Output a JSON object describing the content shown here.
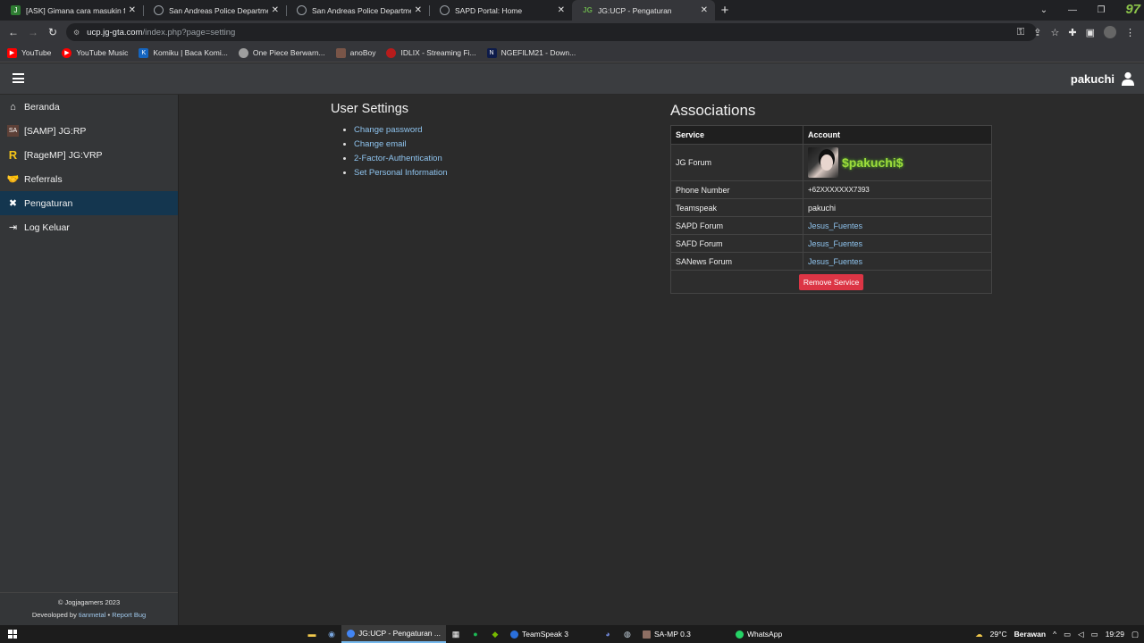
{
  "browser": {
    "tabs": [
      {
        "title": "[ASK] Gimana cara masukin foru",
        "icon": "jg-forum-icon",
        "color": "#2e7d32",
        "active": false
      },
      {
        "title": "San Andreas Police Department",
        "icon": "globe-icon",
        "color": "#9aa0a6",
        "active": false
      },
      {
        "title": "San Andreas Police Department",
        "icon": "globe-icon",
        "color": "#9aa0a6",
        "active": false
      },
      {
        "title": "SAPD Portal: Home",
        "icon": "globe-icon",
        "color": "#9aa0a6",
        "active": false
      },
      {
        "title": "JG:UCP - Pengaturan",
        "icon": "jg-icon",
        "color": "#2e7d32",
        "active": true
      }
    ],
    "url_host": "ucp.jg-gta.com",
    "url_path": "/index.php?page=setting",
    "badge": "97",
    "bookmarks": [
      {
        "label": "YouTube",
        "color": "#ff0000"
      },
      {
        "label": "YouTube Music",
        "color": "#ff0000"
      },
      {
        "label": "Komiku | Baca Komi...",
        "color": "#1565c0"
      },
      {
        "label": "One Piece Berwarn...",
        "color": "#9e9e9e"
      },
      {
        "label": "anoBoy",
        "color": "#795548"
      },
      {
        "label": "IDLIX - Streaming Fi...",
        "color": "#b71c1c"
      },
      {
        "label": "NGEFILM21 - Down...",
        "color": "#0d1b4a"
      }
    ]
  },
  "header": {
    "username": "pakuchi"
  },
  "sidebar": {
    "items": [
      {
        "label": "Beranda",
        "icon": "home-icon",
        "active": false
      },
      {
        "label": "[SAMP] JG:RP",
        "icon": "samp-icon",
        "active": false
      },
      {
        "label": "[RageMP] JG:VRP",
        "icon": "ragemp-icon",
        "active": false
      },
      {
        "label": "Referrals",
        "icon": "handshake-icon",
        "active": false
      },
      {
        "label": "Pengaturan",
        "icon": "tools-icon",
        "active": true
      },
      {
        "label": "Log Keluar",
        "icon": "sign-out-icon",
        "active": false
      }
    ],
    "footer_copyright": "© Jogjagamers 2023",
    "footer_developed": "Deveoloped by",
    "footer_developer": "tianmetal",
    "footer_separator": "•",
    "footer_report": "Report Bug"
  },
  "user_settings": {
    "title": "User Settings",
    "links": [
      "Change password",
      "Change email",
      "2-Factor-Authentication",
      "Set Personal Information"
    ]
  },
  "associations": {
    "title": "Associations",
    "col_service": "Service",
    "col_account": "Account",
    "rows": [
      {
        "service": "JG Forum",
        "account": "$pakuchi$"
      },
      {
        "service": "Phone Number",
        "account": "+62XXXXXXX7393"
      },
      {
        "service": "Teamspeak",
        "account": "pakuchi"
      },
      {
        "service": "SAPD Forum",
        "account": "Jesus_Fuentes"
      },
      {
        "service": "SAFD Forum",
        "account": "Jesus_Fuentes"
      },
      {
        "service": "SANews Forum",
        "account": "Jesus_Fuentes"
      }
    ],
    "remove_label": "Remove Service"
  },
  "taskbar": {
    "apps": [
      {
        "label": "JG:UCP - Pengaturan ...",
        "color": "#4285f4",
        "active": true
      },
      {
        "label": "TeamSpeak 3",
        "color": "#2a6fdb",
        "active": false
      },
      {
        "label": "SA-MP 0.3",
        "color": "#8d6e63",
        "active": false
      },
      {
        "label": "WhatsApp",
        "color": "#25d366",
        "active": false
      }
    ],
    "temperature": "29°C",
    "weather": "Berawan",
    "time": "19:29"
  }
}
